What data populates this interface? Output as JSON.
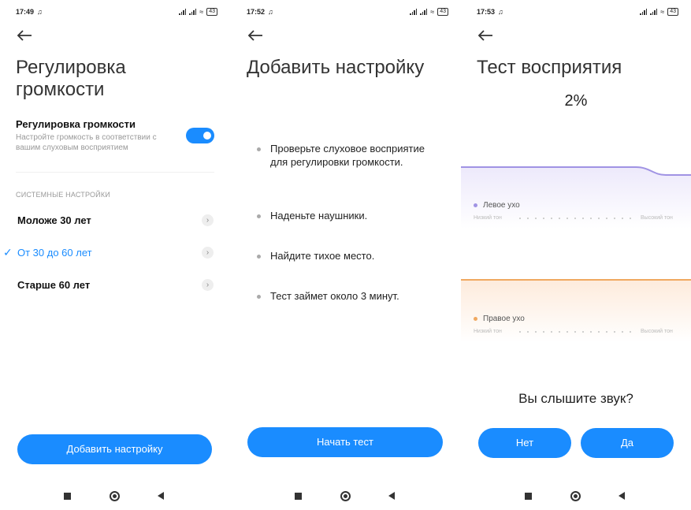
{
  "screens": [
    {
      "status": {
        "time": "17:49",
        "battery": "43"
      },
      "title_line1": "Регулировка",
      "title_line2": "громкости",
      "toggle_row": {
        "title": "Регулировка громкости",
        "subtitle": "Настройте громкость в соответствии с вашим слуховым восприятием",
        "enabled": true
      },
      "section_label": "СИСТЕМНЫЕ НАСТРОЙКИ",
      "options": [
        {
          "label": "Моложе 30 лет",
          "selected": false
        },
        {
          "label": "От 30 до 60 лет",
          "selected": true
        },
        {
          "label": "Старше 60 лет",
          "selected": false
        }
      ],
      "button": "Добавить настройку"
    },
    {
      "status": {
        "time": "17:52",
        "battery": "43"
      },
      "title": "Добавить настройку",
      "bullets": [
        "Проверьте слуховое восприятие для регулировки громкости.",
        "Наденьте наушники.",
        "Найдите тихое место.",
        "Тест займет около 3 минут."
      ],
      "button": "Начать тест"
    },
    {
      "status": {
        "time": "17:53",
        "battery": "43"
      },
      "title": "Тест восприятия",
      "progress": "2%",
      "left_ear": {
        "label": "Левое ухо",
        "low": "Низкий тон",
        "high": "Высокий тон"
      },
      "right_ear": {
        "label": "Правое ухо",
        "low": "Низкий тон",
        "high": "Высокий тон"
      },
      "question": "Вы слышите звук?",
      "no_button": "Нет",
      "yes_button": "Да"
    }
  ],
  "colors": {
    "accent": "#1a8cff",
    "left_ear": "#9a8ce0",
    "right_ear": "#f0a860"
  }
}
